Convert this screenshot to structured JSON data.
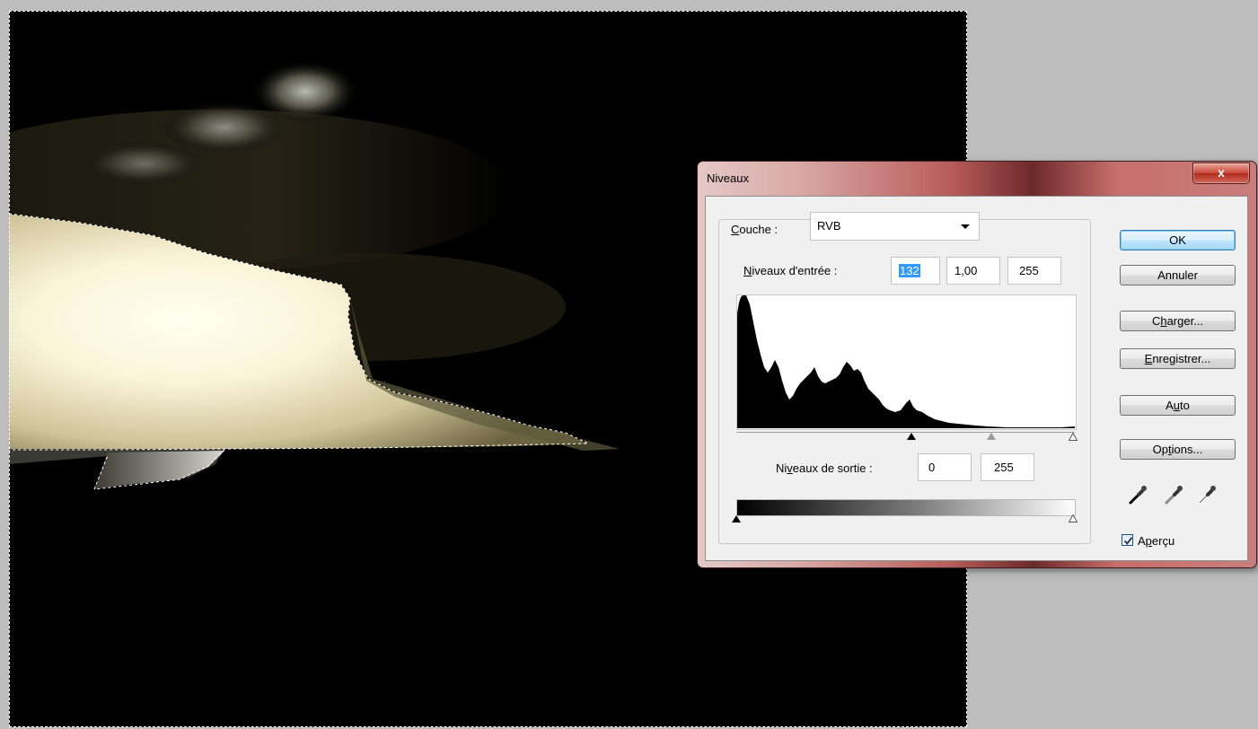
{
  "dialog": {
    "title": "Niveaux",
    "close_glyph": "x",
    "channel": {
      "label_key": "C",
      "label_rest": "ouche :",
      "value": "RVB"
    },
    "input_levels": {
      "label_key": "N",
      "label_rest": "iveaux d'entrée :",
      "black": "132",
      "gamma": "1,00",
      "white": "255"
    },
    "output_levels": {
      "label_pre": "Ni",
      "label_key": "v",
      "label_rest": "eaux de sortie :",
      "black": "0",
      "white": "255"
    },
    "buttons": {
      "ok": "OK",
      "cancel": "Annuler",
      "load_pre": "C",
      "load_key": "h",
      "load_rest": "arger...",
      "save_key": "E",
      "save_rest": "nregistrer...",
      "auto_pre": "A",
      "auto_key": "u",
      "auto_rest": "to",
      "options_pre": "Op",
      "options_key": "t",
      "options_rest": "ions..."
    },
    "preview": {
      "label_pre": "A",
      "label_key": "p",
      "label_rest": "erçu",
      "checked": true
    },
    "eyedroppers": [
      "black-eyedropper-icon",
      "grey-eyedropper-icon",
      "white-eyedropper-icon"
    ]
  },
  "colors": {
    "selected_text_bg": "#3399ff",
    "ok_button_border": "#3c7fb1",
    "close_button": "#c8473a"
  }
}
